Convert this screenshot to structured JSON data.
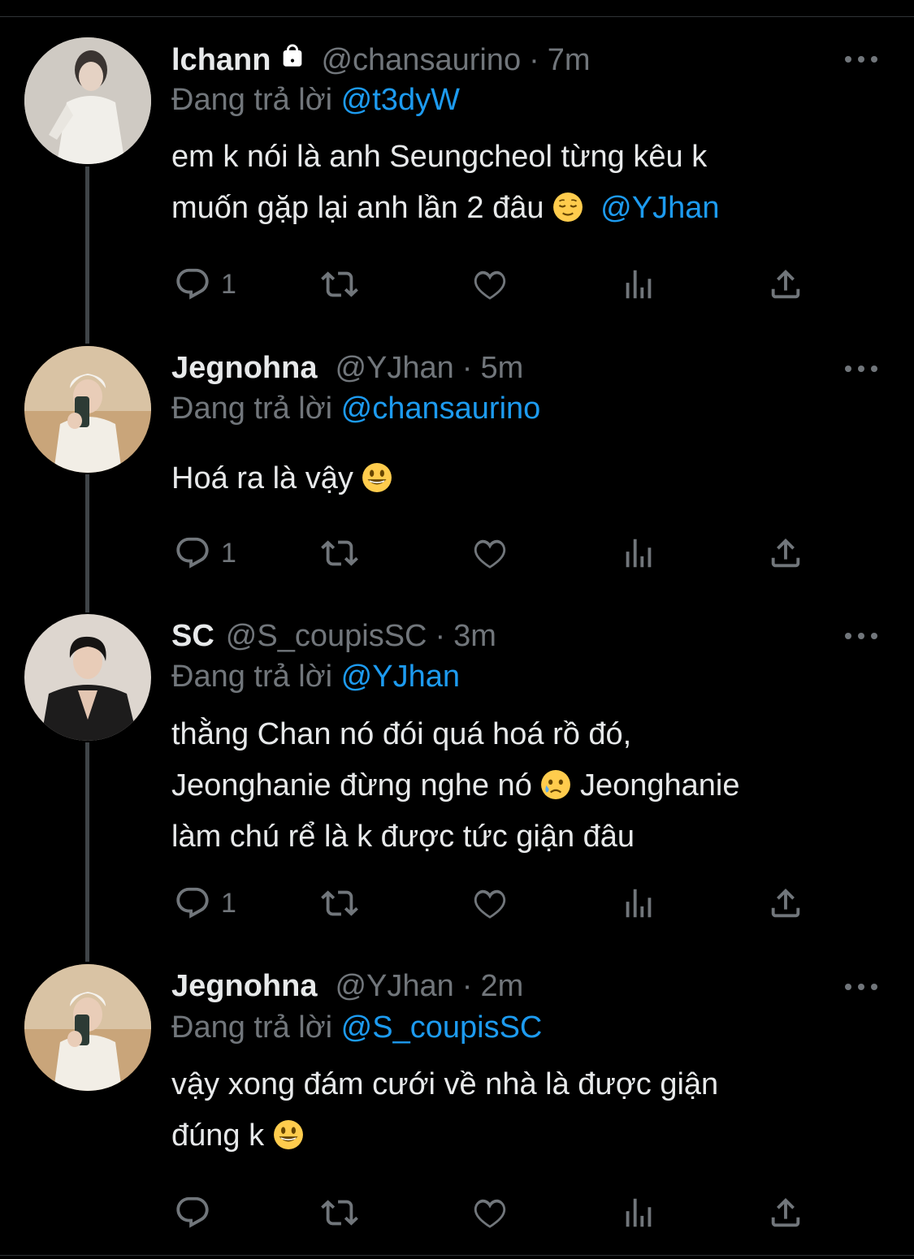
{
  "colors": {
    "background": "#000000",
    "text": "#e7e9ea",
    "muted": "#71767b",
    "link": "#1d9bf0",
    "thread": "#3f4448"
  },
  "tweets": [
    {
      "name": "lchann",
      "handle": "@chansaurino",
      "dot": "·",
      "time": "7m",
      "protected": true,
      "replying_label": "Đang trả lời",
      "replying_to": "@t3dyW",
      "lines": [
        "em k nói là anh Seungcheol từng kêu k",
        "muốn gặp lại anh lần 2 đâu"
      ],
      "emoji": "relieved-face",
      "trailing_mention": "@YJhan",
      "reply_count": "1"
    },
    {
      "name": "Jegnohna",
      "handle": "@YJhan",
      "dot": "·",
      "time": "5m",
      "replying_label": "Đang trả lời",
      "replying_to": "@chansaurino",
      "lines": [
        "Hoá ra là vậy"
      ],
      "emoji": "grinning-face",
      "reply_count": "1"
    },
    {
      "name": "SC",
      "handle": "@S_coupisSC",
      "dot": "·",
      "time": "3m",
      "replying_label": "Đang trả lời",
      "replying_to": "@YJhan",
      "lines": [
        "thằng Chan nó đói quá hoá rồ đó,",
        "Jeonghanie đừng nghe nó",
        "Jeonghanie",
        "làm chú rể là k được tức giận đâu"
      ],
      "emoji": "crying-face",
      "reply_count": "1"
    },
    {
      "name": "Jegnohna",
      "handle": "@YJhan",
      "dot": "·",
      "time": "2m",
      "replying_label": "Đang trả lời",
      "replying_to": "@S_coupisSC",
      "lines": [
        "vậy xong đám cưới về nhà là được giận",
        "đúng k"
      ],
      "emoji": "grinning-face",
      "reply_count": ""
    }
  ]
}
